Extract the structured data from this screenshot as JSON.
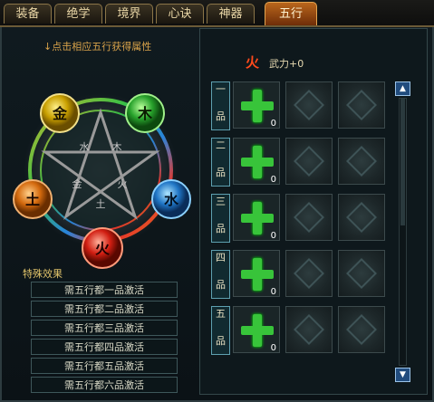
{
  "tabs": [
    {
      "label": "装备",
      "active": false
    },
    {
      "label": "绝学",
      "active": false
    },
    {
      "label": "境界",
      "active": false
    },
    {
      "label": "心诀",
      "active": false
    },
    {
      "label": "神器",
      "active": false
    },
    {
      "label": "五行",
      "active": true
    }
  ],
  "left": {
    "hint": "↓点击相应五行获得属性",
    "elements": {
      "metal": "金",
      "wood": "木",
      "earth": "土",
      "water": "水",
      "fire": "火"
    },
    "rune_glyphs": [
      "木",
      "火",
      "土",
      "金",
      "水"
    ],
    "special_title": "特殊效果",
    "requirements": [
      "需五行都一品激活",
      "需五行都二品激活",
      "需五行都三品激活",
      "需五行都四品激活",
      "需五行都五品激活",
      "需五行都六品激活"
    ]
  },
  "right": {
    "element": "火",
    "stat": "武力+0",
    "grades": [
      {
        "chars": [
          "一",
          "品"
        ],
        "count": "0"
      },
      {
        "chars": [
          "二",
          "品"
        ],
        "count": "0"
      },
      {
        "chars": [
          "三",
          "品"
        ],
        "count": "0"
      },
      {
        "chars": [
          "四",
          "品"
        ],
        "count": "0"
      },
      {
        "chars": [
          "五",
          "品"
        ],
        "count": "0"
      }
    ]
  },
  "colors": {
    "metal": "#c9a000",
    "wood": "#27a12b",
    "earth": "#d46a0e",
    "water": "#1f75c5",
    "fire": "#d11e12",
    "active_tab": "#b9661c"
  }
}
